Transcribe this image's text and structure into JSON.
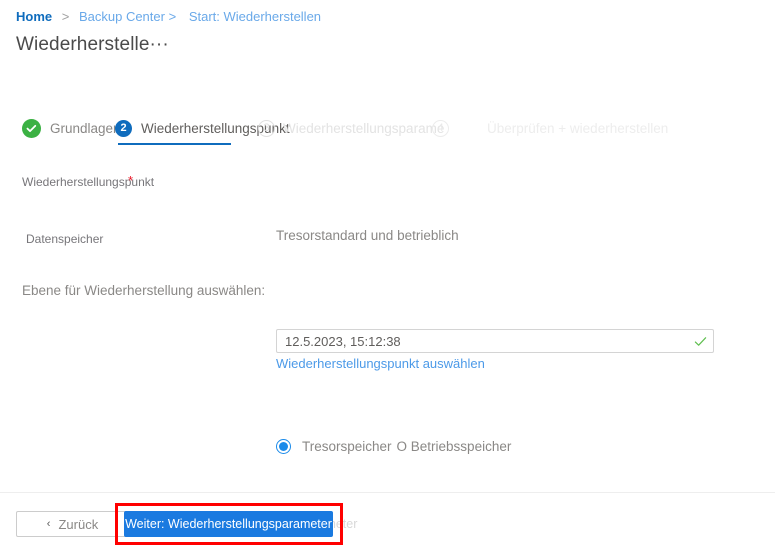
{
  "breadcrumb": {
    "home": "Home",
    "sep": ">",
    "item2": "Backup Center",
    "sep2": ">",
    "item3": "Start: Wiederherstellen"
  },
  "page": {
    "title": "Wiederherstelle···",
    "accent_color": "#0f6cbd"
  },
  "wizard": {
    "steps": [
      {
        "label": "Grundlagen",
        "state": "completed",
        "icon": "check-icon"
      },
      {
        "label": "Wiederherstellungspunkt",
        "number": "2",
        "state": "active"
      },
      {
        "label": "Wiederherstellungsparame",
        "number": "3",
        "state": "upcoming"
      },
      {
        "label": "Überprüfen + wiederherstellen",
        "number": "4",
        "state": "upcoming"
      }
    ]
  },
  "form": {
    "recovery_point": {
      "label": "Wiederherstellungspunkt",
      "required_mark": "*",
      "value": "12.5.2023, 15:12:38",
      "valid_icon": "checkmark-icon",
      "link": "Wiederherstellungspunkt auswählen"
    },
    "data_store": {
      "label": "Datenspeicher",
      "value": "Tresorstandard und betrieblich"
    },
    "tier": {
      "label": "Ebene für Wiederherstellung auswählen:",
      "options": [
        {
          "label": "Tresorspeicher",
          "selected": true
        },
        {
          "label": "O Betriebsspeicher",
          "selected": false
        }
      ]
    }
  },
  "footer": {
    "back_chevron": "‹",
    "back_label": "Zurück",
    "next_label": "Weiter: Wiederherstellungsparameter",
    "next_label_visible": "Weiter: Wiederherstellungsparame",
    "next_label_overflow": "Weiter: Wiederherstellungsparameter",
    "highlight_color": "#ff0000",
    "next_color": "#1a7ae0"
  }
}
